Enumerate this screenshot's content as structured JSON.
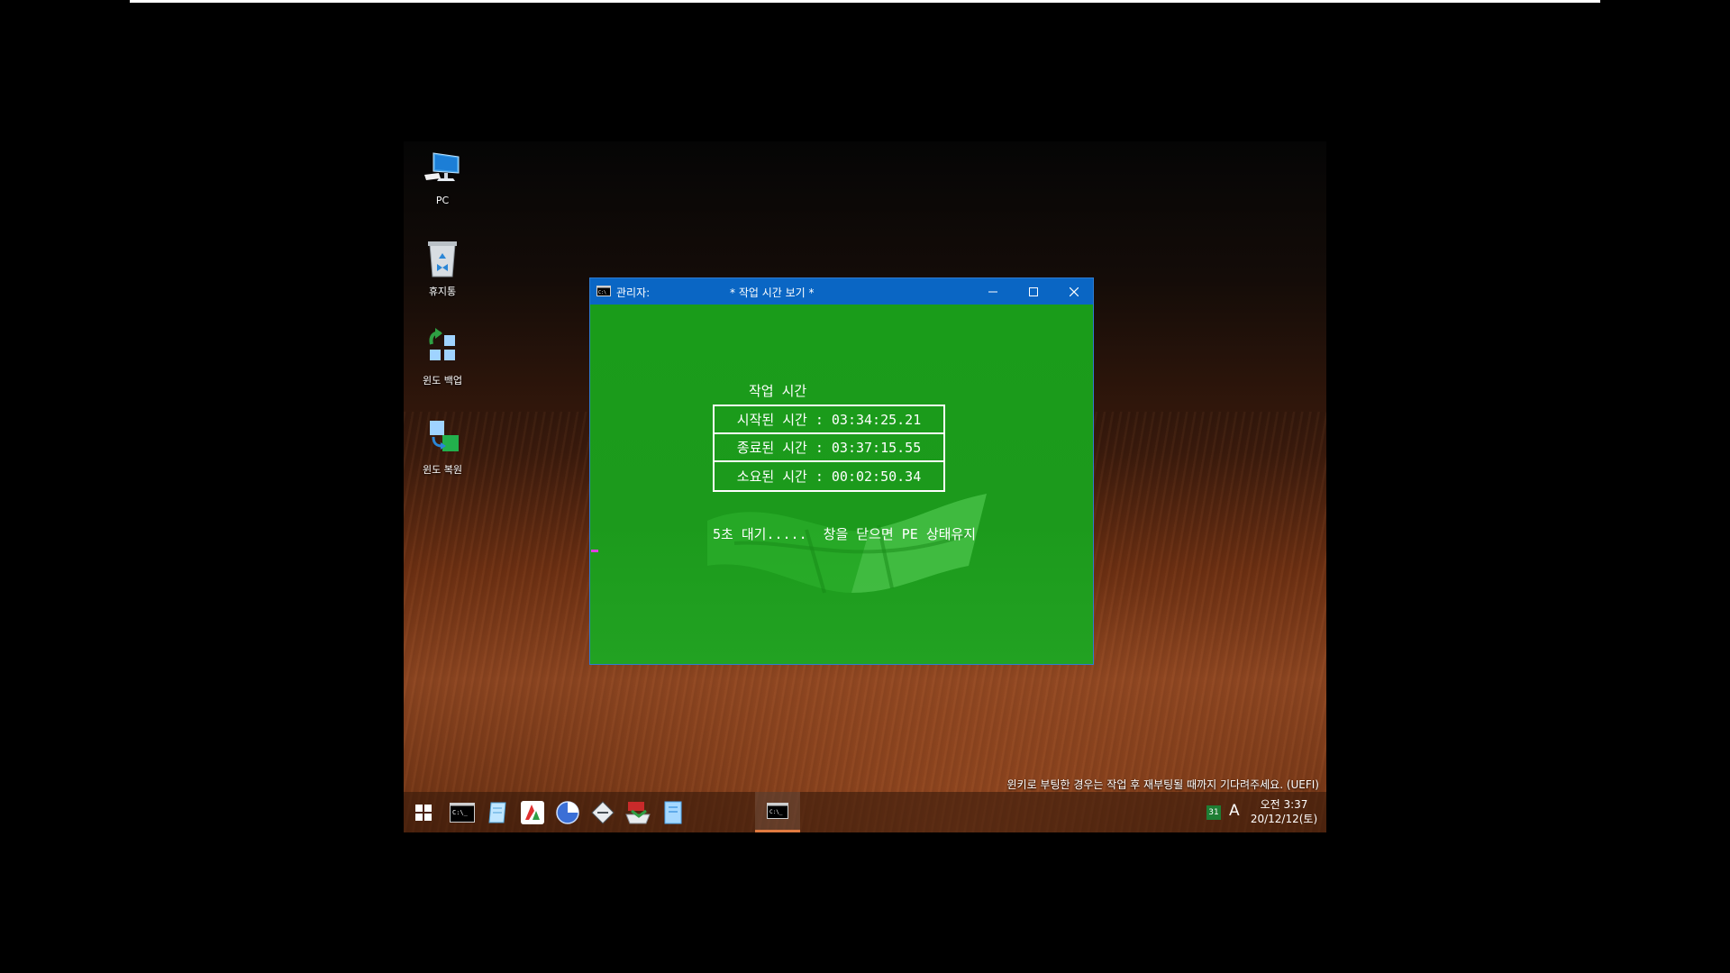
{
  "desktop": {
    "icons": [
      {
        "label": "PC",
        "icon": "computer-icon"
      },
      {
        "label": "휴지통",
        "icon": "recycle-bin-icon"
      },
      {
        "label": "윈도 백업",
        "icon": "windows-backup-icon"
      },
      {
        "label": "윈도 복원",
        "icon": "windows-restore-icon"
      }
    ],
    "boot_message": "윈키로 부팅한 경우는 작업 후 재부팅될 때까지 기다려주세요. (UEFI)"
  },
  "console_window": {
    "admin_label": "관리자:",
    "title": "* 작업 시간 보기 *",
    "heading": "작업 시간",
    "rows": [
      "시작된 시간 : 03:34:25.21",
      "종료된 시간 : 03:37:15.55",
      "소요된 시간 : 00:02:50.34"
    ],
    "wait_message": "5초 대기.....  창을 닫으면 PE 상태유지",
    "colors": {
      "background": "#1a9a1a",
      "titlebar": "#0a66c4",
      "text": "#ffffff"
    }
  },
  "taskbar": {
    "pinned": [
      "windows-start-icon",
      "cmd-icon",
      "notepad-icon",
      "ai-app-icon",
      "disk-chart-icon",
      "drive-tool-icon",
      "installer-icon",
      "document-icon"
    ],
    "active_app": "cmd-icon",
    "tray": {
      "calendar_day": "31",
      "ime": "A",
      "time": "오전 3:37",
      "date": "20/12/12(토)"
    }
  }
}
